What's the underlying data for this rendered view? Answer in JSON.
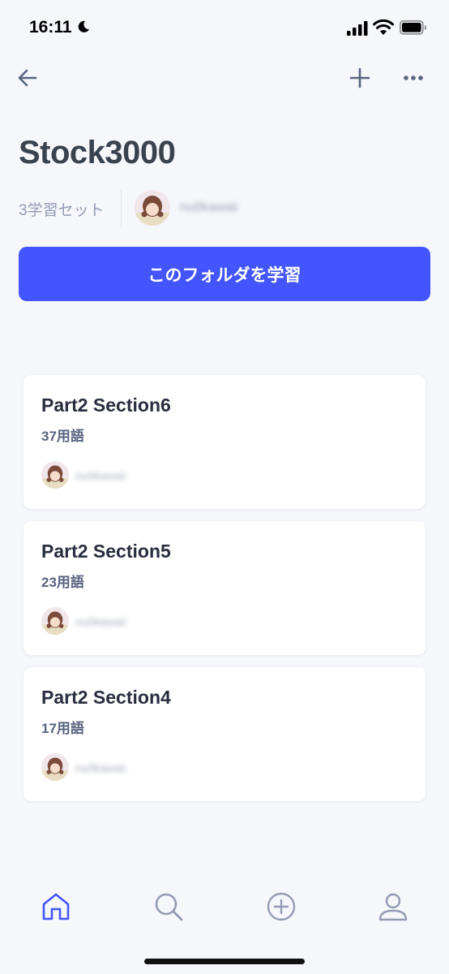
{
  "status_bar": {
    "time": "16:11"
  },
  "folder": {
    "title": "Stock3000",
    "set_count": "3学習セット",
    "owner_name": "nu0kawaii"
  },
  "study_button": {
    "label": "このフォルダを学習"
  },
  "sets": [
    {
      "title": "Part2 Section6",
      "terms": "37用語",
      "owner": "nu0kawaii"
    },
    {
      "title": "Part2 Section5",
      "terms": "23用語",
      "owner": "nu0kawaii"
    },
    {
      "title": "Part2 Section4",
      "terms": "17用語",
      "owner": "nu0kawaii"
    }
  ],
  "tab_bar": {
    "items": [
      "home-icon",
      "search-icon",
      "create-icon",
      "profile-icon"
    ],
    "active": "home-icon"
  },
  "colors": {
    "accent": "#4255ff",
    "background": "#f6f7fb",
    "title": "#39434f",
    "muted": "#939bb4"
  }
}
